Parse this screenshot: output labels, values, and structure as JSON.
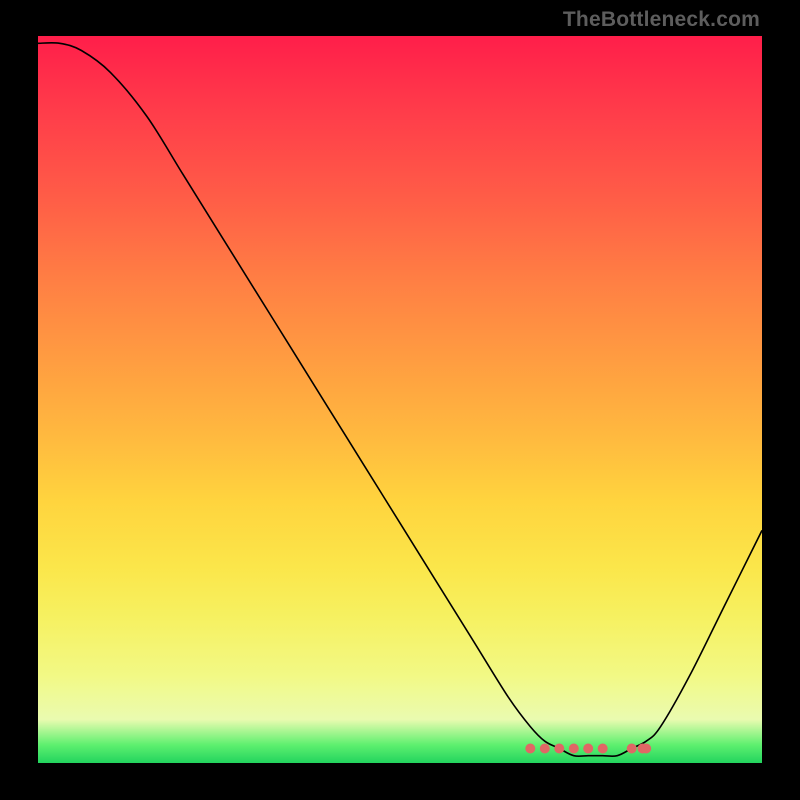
{
  "watermark": "TheBottleneck.com",
  "colors": {
    "background": "#000000",
    "gradient_top": "#ff1e4a",
    "gradient_bottom": "#22d45e",
    "curve": "#000000",
    "flat_dots": "#e06765",
    "watermark_text": "#5d5d5d"
  },
  "chart_data": {
    "type": "line",
    "title": "",
    "xlabel": "",
    "ylabel": "",
    "xlim": [
      0,
      100
    ],
    "ylim": [
      0,
      100
    ],
    "x": [
      0,
      3,
      6,
      10,
      15,
      20,
      25,
      30,
      35,
      40,
      45,
      50,
      55,
      60,
      65,
      68,
      70,
      72,
      74,
      76,
      78,
      80,
      82,
      84,
      86,
      90,
      95,
      100
    ],
    "values": [
      99,
      99,
      98,
      95,
      89,
      81,
      73,
      65,
      57,
      49,
      41,
      33,
      25,
      17,
      9,
      5,
      3,
      2,
      1,
      1,
      1,
      1,
      2,
      3,
      5,
      12,
      22,
      32
    ],
    "flat_region": {
      "x_start": 68,
      "x_end": 84,
      "y": 2,
      "dot_x": [
        68,
        70,
        72,
        74,
        76,
        78,
        82,
        83.5,
        84
      ]
    },
    "annotations": []
  }
}
